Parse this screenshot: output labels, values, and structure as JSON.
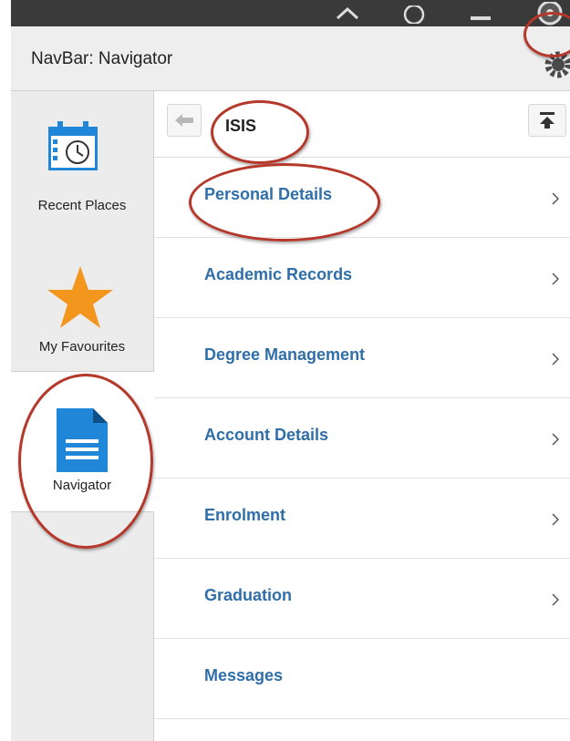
{
  "header": {
    "title": "NavBar: Navigator"
  },
  "sidebar": {
    "items": [
      {
        "label": "Recent Places",
        "icon": "calendar-clock-icon"
      },
      {
        "label": "My Favourites",
        "icon": "star-icon"
      },
      {
        "label": "Navigator",
        "icon": "document-icon"
      }
    ]
  },
  "content": {
    "title": "ISIS",
    "items": [
      {
        "label": "Personal Details"
      },
      {
        "label": "Academic Records"
      },
      {
        "label": "Degree Management"
      },
      {
        "label": "Account Details"
      },
      {
        "label": "Enrolment"
      },
      {
        "label": "Graduation"
      },
      {
        "label": "Messages"
      }
    ]
  },
  "colors": {
    "link": "#2f6ea8",
    "accent_blue": "#1f86d8",
    "star": "#f3961d",
    "annotation": "#b5382b",
    "topbar": "#3a3a3a"
  }
}
